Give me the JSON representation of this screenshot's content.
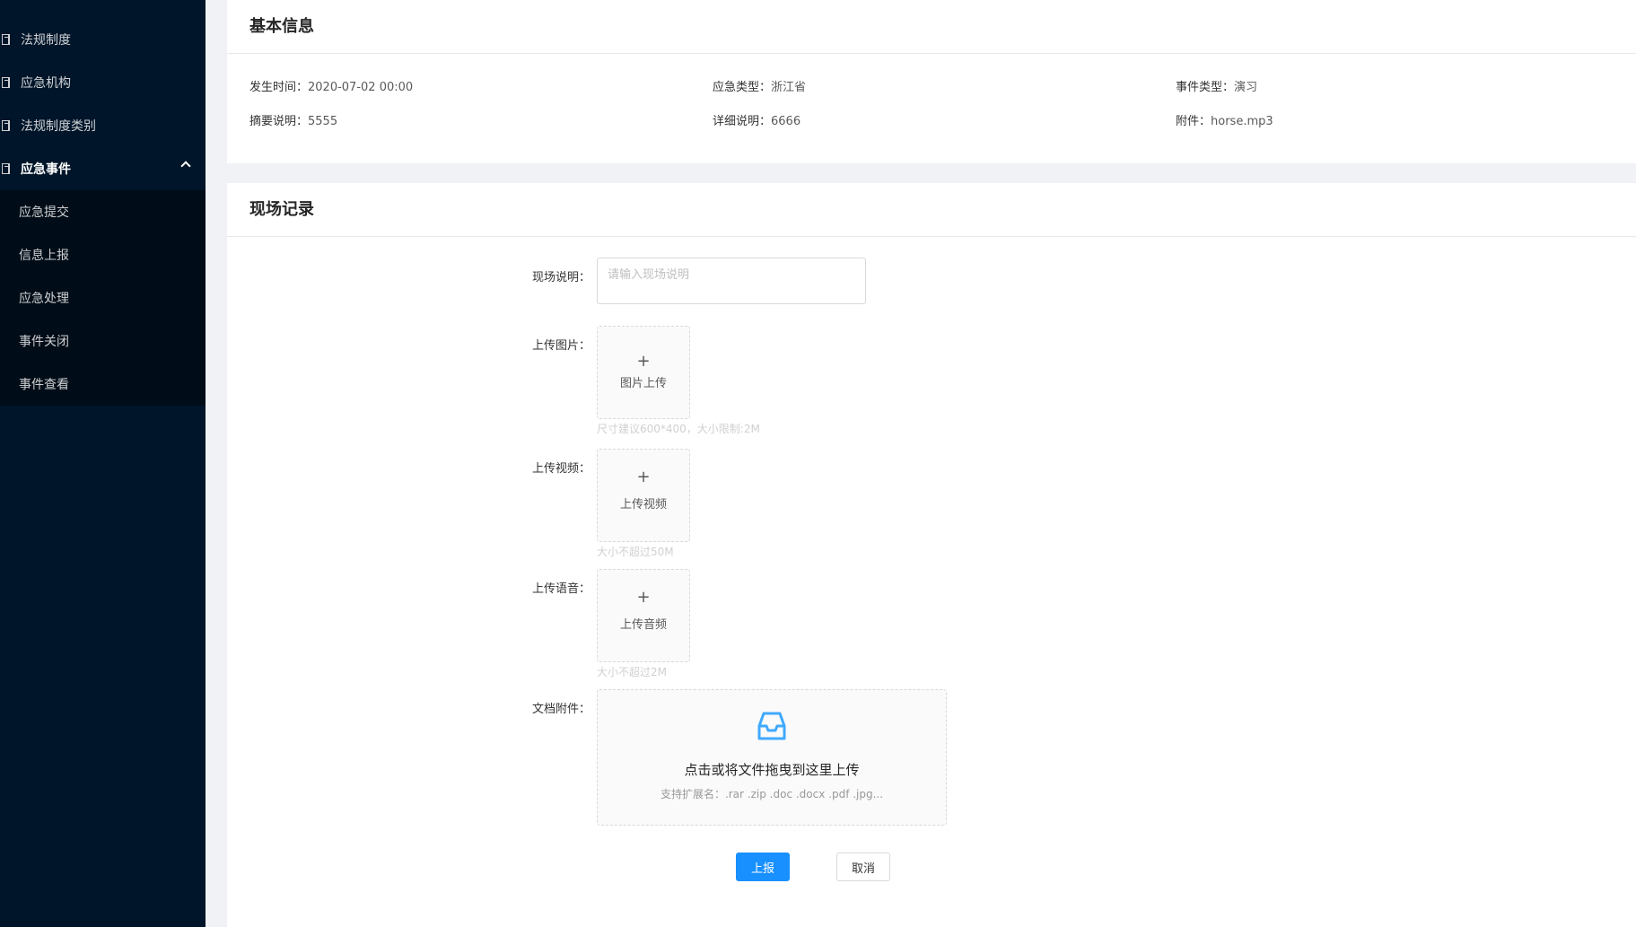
{
  "sidebar": {
    "items": [
      {
        "label": "法规制度"
      },
      {
        "label": "应急机构"
      },
      {
        "label": "法规制度类别"
      },
      {
        "label": "应急事件"
      }
    ],
    "submenu": [
      {
        "label": "应急提交"
      },
      {
        "label": "信息上报"
      },
      {
        "label": "应急处理"
      },
      {
        "label": "事件关闭"
      },
      {
        "label": "事件查看"
      }
    ]
  },
  "basic_info": {
    "title": "基本信息",
    "occur_time_label": "发生时间：",
    "occur_time_value": "2020-07-02 00:00",
    "emergency_type_label": "应急类型：",
    "emergency_type_value": "浙江省",
    "event_type_label": "事件类型：",
    "event_type_value": "演习",
    "summary_label": "摘要说明：",
    "summary_value": "5555",
    "detail_label": "详细说明：",
    "detail_value": "6666",
    "attachment_label": "附件：",
    "attachment_value": "horse.mp3"
  },
  "record": {
    "title": "现场记录",
    "desc_label": "现场说明：",
    "desc_placeholder": "请输入现场说明",
    "image_label": "上传图片：",
    "image_button": "图片上传",
    "image_hint": "尺寸建议600*400，大小限制:2M",
    "video_label": "上传视频：",
    "video_button": "上传视频",
    "video_hint": "大小不超过50M",
    "audio_label": "上传语音：",
    "audio_button": "上传音频",
    "audio_hint": "大小不超过2M",
    "doc_label": "文档附件：",
    "doc_main_text": "点击或将文件拖曳到这里上传",
    "doc_sub_text": "支持扩展名：.rar .zip .doc .docx .pdf .jpg...",
    "plus": "+"
  },
  "actions": {
    "submit_label": "上报",
    "cancel_label": "取消"
  },
  "colors": {
    "sidebar_bg": "#001529",
    "submenu_bg": "#000c17",
    "primary": "#1890ff"
  }
}
